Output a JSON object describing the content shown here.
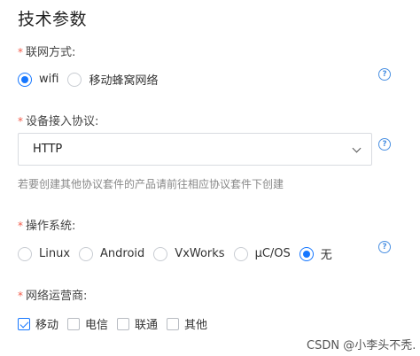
{
  "page": {
    "title": "技术参数"
  },
  "network": {
    "label": "联网方式:",
    "options": [
      {
        "label": "wifi",
        "checked": true
      },
      {
        "label": "移动蜂窝网络",
        "checked": false
      }
    ]
  },
  "protocol": {
    "label": "设备接入协议:",
    "selected": "HTTP",
    "hint": "若要创建其他协议套件的产品请前往相应协议套件下创建"
  },
  "os": {
    "label": "操作系统:",
    "options": [
      {
        "label": "Linux",
        "checked": false
      },
      {
        "label": "Android",
        "checked": false
      },
      {
        "label": "VxWorks",
        "checked": false
      },
      {
        "label": "μC/OS",
        "checked": false
      },
      {
        "label": "无",
        "checked": true
      }
    ]
  },
  "carrier": {
    "label": "网络运营商:",
    "options": [
      {
        "label": "移动",
        "checked": true
      },
      {
        "label": "电信",
        "checked": false
      },
      {
        "label": "联通",
        "checked": false
      },
      {
        "label": "其他",
        "checked": false
      }
    ]
  },
  "required_mark": "*",
  "help_glyph": "?",
  "watermark": "CSDN @小李头不秃."
}
